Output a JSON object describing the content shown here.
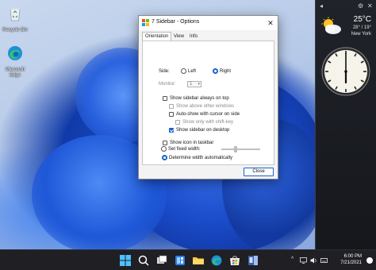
{
  "desktop": {
    "icons": [
      {
        "label": "Recycle Bin",
        "icon": "recycle-bin-icon"
      },
      {
        "label": "Microsoft Edge",
        "icon": "edge-icon"
      }
    ]
  },
  "sidebar": {
    "top_left": "◂",
    "top_right_a": "⚙",
    "top_right_b": "✕",
    "weather": {
      "temperature": "25°C",
      "range": "28° / 19°",
      "city": "New York",
      "icon": "partly-cloudy-icon"
    },
    "clock": {
      "hour": 6,
      "minute": 0
    }
  },
  "dialog": {
    "title": "7 Sidebar - Options",
    "close": "✕",
    "tabs": [
      "Orientation",
      "View",
      "Info"
    ],
    "active_tab": "Orientation",
    "side_label": "Side:",
    "side_left": "Left",
    "side_right": "Right",
    "monitor_label": "Monitor:",
    "monitor_value": "1",
    "always_on_top": "Show sidebar always on top",
    "above_other": "Show above other windows",
    "autoshow": "Auto-show with cursor on side",
    "only_shift": "Show only with shift-key",
    "show_desktop": "Show sidebar on desktop",
    "show_taskbar": "Show icon in taskbar",
    "determine_width": "Determine width automatically",
    "fixed_width": "Set fixed width:",
    "close_button": "Close"
  },
  "taskbar": {
    "tray_chevron": "^",
    "time": "6:00 PM",
    "date": "7/21/2021",
    "accent": "#6aa5f5"
  }
}
